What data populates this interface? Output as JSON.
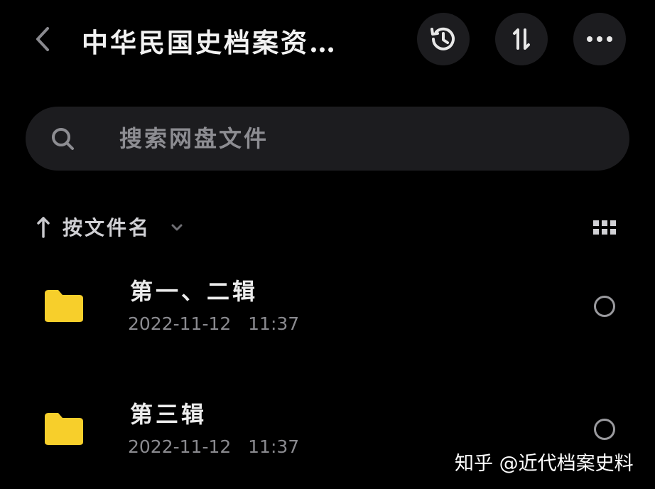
{
  "header": {
    "title": "中华民国史档案资…",
    "back_icon": "chevron-left-icon",
    "actions": [
      {
        "name": "history",
        "icon": "history-icon"
      },
      {
        "name": "sort",
        "icon": "sort-swap-icon"
      },
      {
        "name": "more",
        "icon": "more-horizontal-icon"
      }
    ]
  },
  "search": {
    "placeholder": "搜索网盘文件",
    "value": "",
    "icon": "search-icon"
  },
  "sort": {
    "label": "按文件名",
    "direction_icon": "arrow-up-icon",
    "dropdown_icon": "chevron-down-icon",
    "view_toggle_icon": "grid-view-icon"
  },
  "files": [
    {
      "name": "第一、二辑",
      "date": "2022-11-12",
      "time": "11:37",
      "icon": "folder-icon",
      "selected": false
    },
    {
      "name": "第三辑",
      "date": "2022-11-12",
      "time": "11:37",
      "icon": "folder-icon",
      "selected": false
    }
  ],
  "watermark": "知乎 @近代档案史料",
  "colors": {
    "background": "#000000",
    "surface": "#1c1c1f",
    "folder": "#f7cf2b",
    "text_primary": "#ececec",
    "text_secondary": "#8a8a8f"
  }
}
